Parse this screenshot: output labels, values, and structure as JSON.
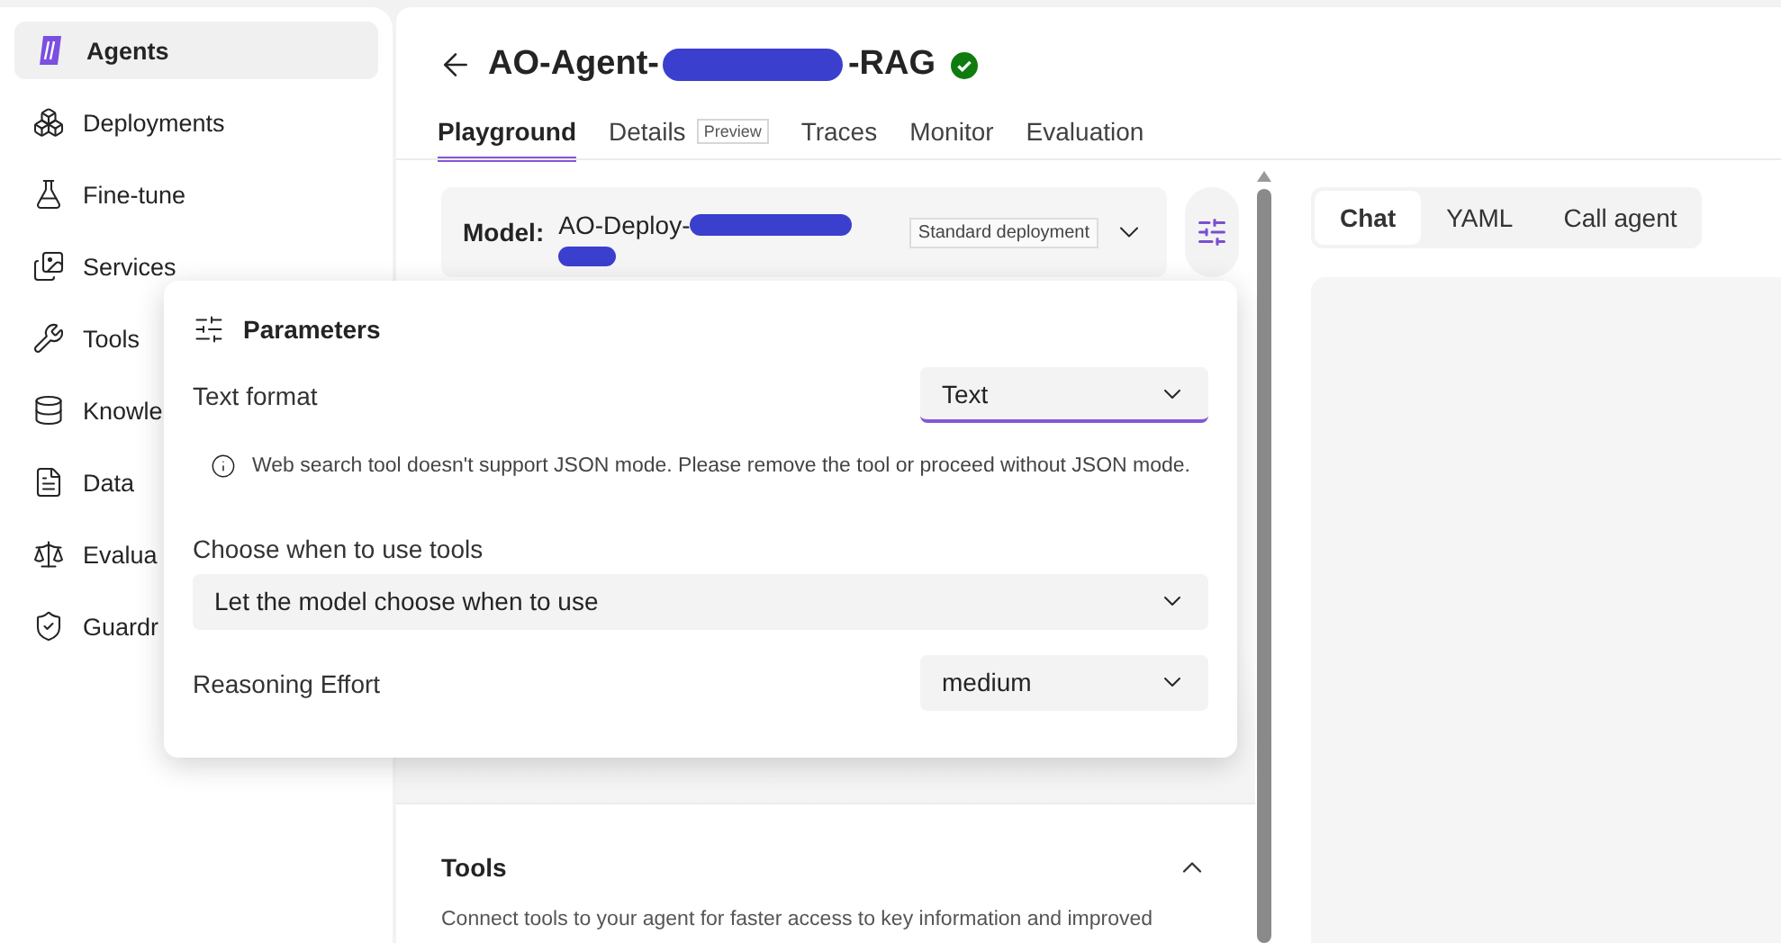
{
  "sidebar": {
    "items": [
      {
        "label": "Agents",
        "selected": true
      },
      {
        "label": "Deployments",
        "selected": false
      },
      {
        "label": "Fine-tune",
        "selected": false
      },
      {
        "label": "Services",
        "selected": false
      },
      {
        "label": "Tools",
        "selected": false
      },
      {
        "label": "Knowle",
        "selected": false
      },
      {
        "label": "Data",
        "selected": false
      },
      {
        "label": "Evalua",
        "selected": false
      },
      {
        "label": "Guardr",
        "selected": false
      }
    ]
  },
  "header": {
    "title_start": "AO-Agent-",
    "title_end": "-RAG",
    "verified": true
  },
  "tabs": [
    {
      "label": "Playground",
      "selected": true
    },
    {
      "label": "Details",
      "badge": "Preview",
      "selected": false
    },
    {
      "label": "Traces",
      "selected": false
    },
    {
      "label": "Monitor",
      "selected": false
    },
    {
      "label": "Evaluation",
      "selected": false
    }
  ],
  "model": {
    "label": "Model:",
    "value": "AO-Deploy-",
    "tag": "Standard deployment"
  },
  "parameters": {
    "title": "Parameters",
    "fields": [
      {
        "kind": "inline",
        "label": "Text format",
        "value": "Text",
        "focused": true
      },
      {
        "kind": "note",
        "text": "Web search tool doesn't support JSON mode. Please remove the tool or proceed without JSON mode."
      },
      {
        "kind": "stacked",
        "label": "Choose when to use tools",
        "value": "Let the model choose when to use",
        "focused": false
      },
      {
        "kind": "inline",
        "label": "Reasoning Effort",
        "value": "medium",
        "focused": false
      }
    ]
  },
  "tools_section": {
    "title": "Tools",
    "description": "Connect tools to your agent for faster access to key information and improved",
    "expanded": true
  },
  "right_tabs": [
    {
      "label": "Chat",
      "selected": true
    },
    {
      "label": "YAML",
      "selected": false
    },
    {
      "label": "Call agent",
      "selected": false
    }
  ]
}
